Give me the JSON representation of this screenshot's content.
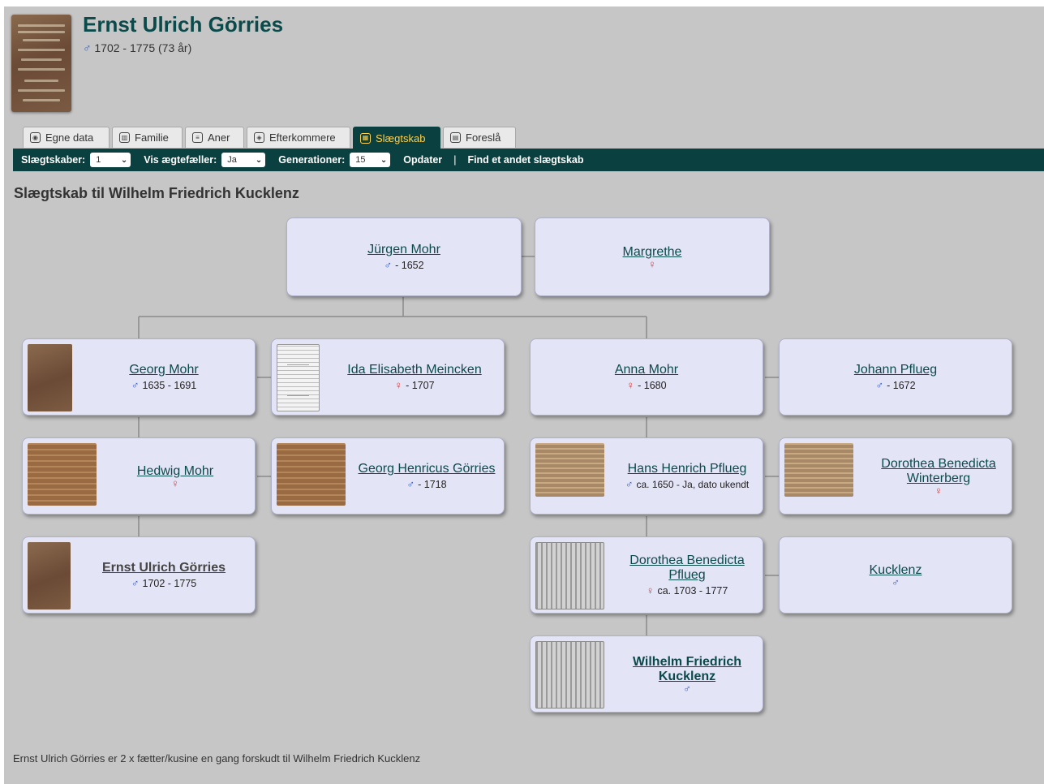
{
  "header": {
    "name": "Ernst Ulrich Görries",
    "male_symbol": "♂",
    "life": "1702 - 1775  (73 år)"
  },
  "tabs": [
    {
      "label": "Egne data",
      "icon": "person-icon"
    },
    {
      "label": "Familie",
      "icon": "family-icon"
    },
    {
      "label": "Aner",
      "icon": "ancestors-icon"
    },
    {
      "label": "Efterkommere",
      "icon": "descendants-icon"
    },
    {
      "label": "Slægtskab",
      "icon": "relationship-icon",
      "active": true
    },
    {
      "label": "Foreslå",
      "icon": "suggest-icon"
    }
  ],
  "toolbar": {
    "relations_label": "Slægtskaber:",
    "relations_value": "1",
    "spouses_label": "Vis ægtefæller:",
    "spouses_value": "Ja",
    "generations_label": "Generationer:",
    "generations_value": "15",
    "update_label": "Opdater",
    "separator": "|",
    "find_label": "Find et andet slægtskab"
  },
  "heading": "Slægtskab til Wilhelm Friedrich Kucklenz",
  "people": {
    "jurgen": {
      "name": "Jürgen Mohr",
      "sex": "♂",
      "dates": "- 1652"
    },
    "margrethe": {
      "name": "Margrethe",
      "sex": "♀",
      "dates": ""
    },
    "georg": {
      "name": "Georg Mohr",
      "sex": "♂",
      "dates": "1635 - 1691"
    },
    "ida": {
      "name": "Ida Elisabeth Meincken",
      "sex": "♀",
      "dates": "- 1707"
    },
    "anna": {
      "name": "Anna Mohr",
      "sex": "♀",
      "dates": "- 1680"
    },
    "johann": {
      "name": "Johann Pflueg",
      "sex": "♂",
      "dates": "- 1672"
    },
    "hedwig": {
      "name": "Hedwig Mohr",
      "sex": "♀",
      "dates": ""
    },
    "georg_henricus": {
      "name": "Georg Henricus Görries",
      "sex": "♂",
      "dates": "- 1718"
    },
    "hans": {
      "name": "Hans Henrich Pflueg",
      "sex": "♂",
      "dates": "ca. 1650 - Ja, dato ukendt"
    },
    "dorothea_w": {
      "name": "Dorothea Benedicta Winterberg",
      "sex": "♀",
      "dates": ""
    },
    "ernst": {
      "name": "Ernst Ulrich Görries",
      "sex": "♂",
      "dates": "1702 - 1775"
    },
    "dorothea_p": {
      "name": "Dorothea Benedicta Pflueg",
      "sex": "♀",
      "dates": "ca. 1703 - 1777"
    },
    "kucklenz": {
      "name": "Kucklenz",
      "sex": "♂",
      "dates": ""
    },
    "wilhelm": {
      "name": "Wilhelm Friedrich Kucklenz",
      "sex": "♂",
      "dates": ""
    }
  },
  "footer": "Ernst Ulrich Görries er 2 x fætter/kusine en gang forskudt til Wilhelm Friedrich Kucklenz",
  "colors": {
    "accent": "#0b4040",
    "active_tab_text": "#ffd04a",
    "male": "#3a5bb5",
    "female": "#d23c3c",
    "card": "#e4e4f7"
  }
}
